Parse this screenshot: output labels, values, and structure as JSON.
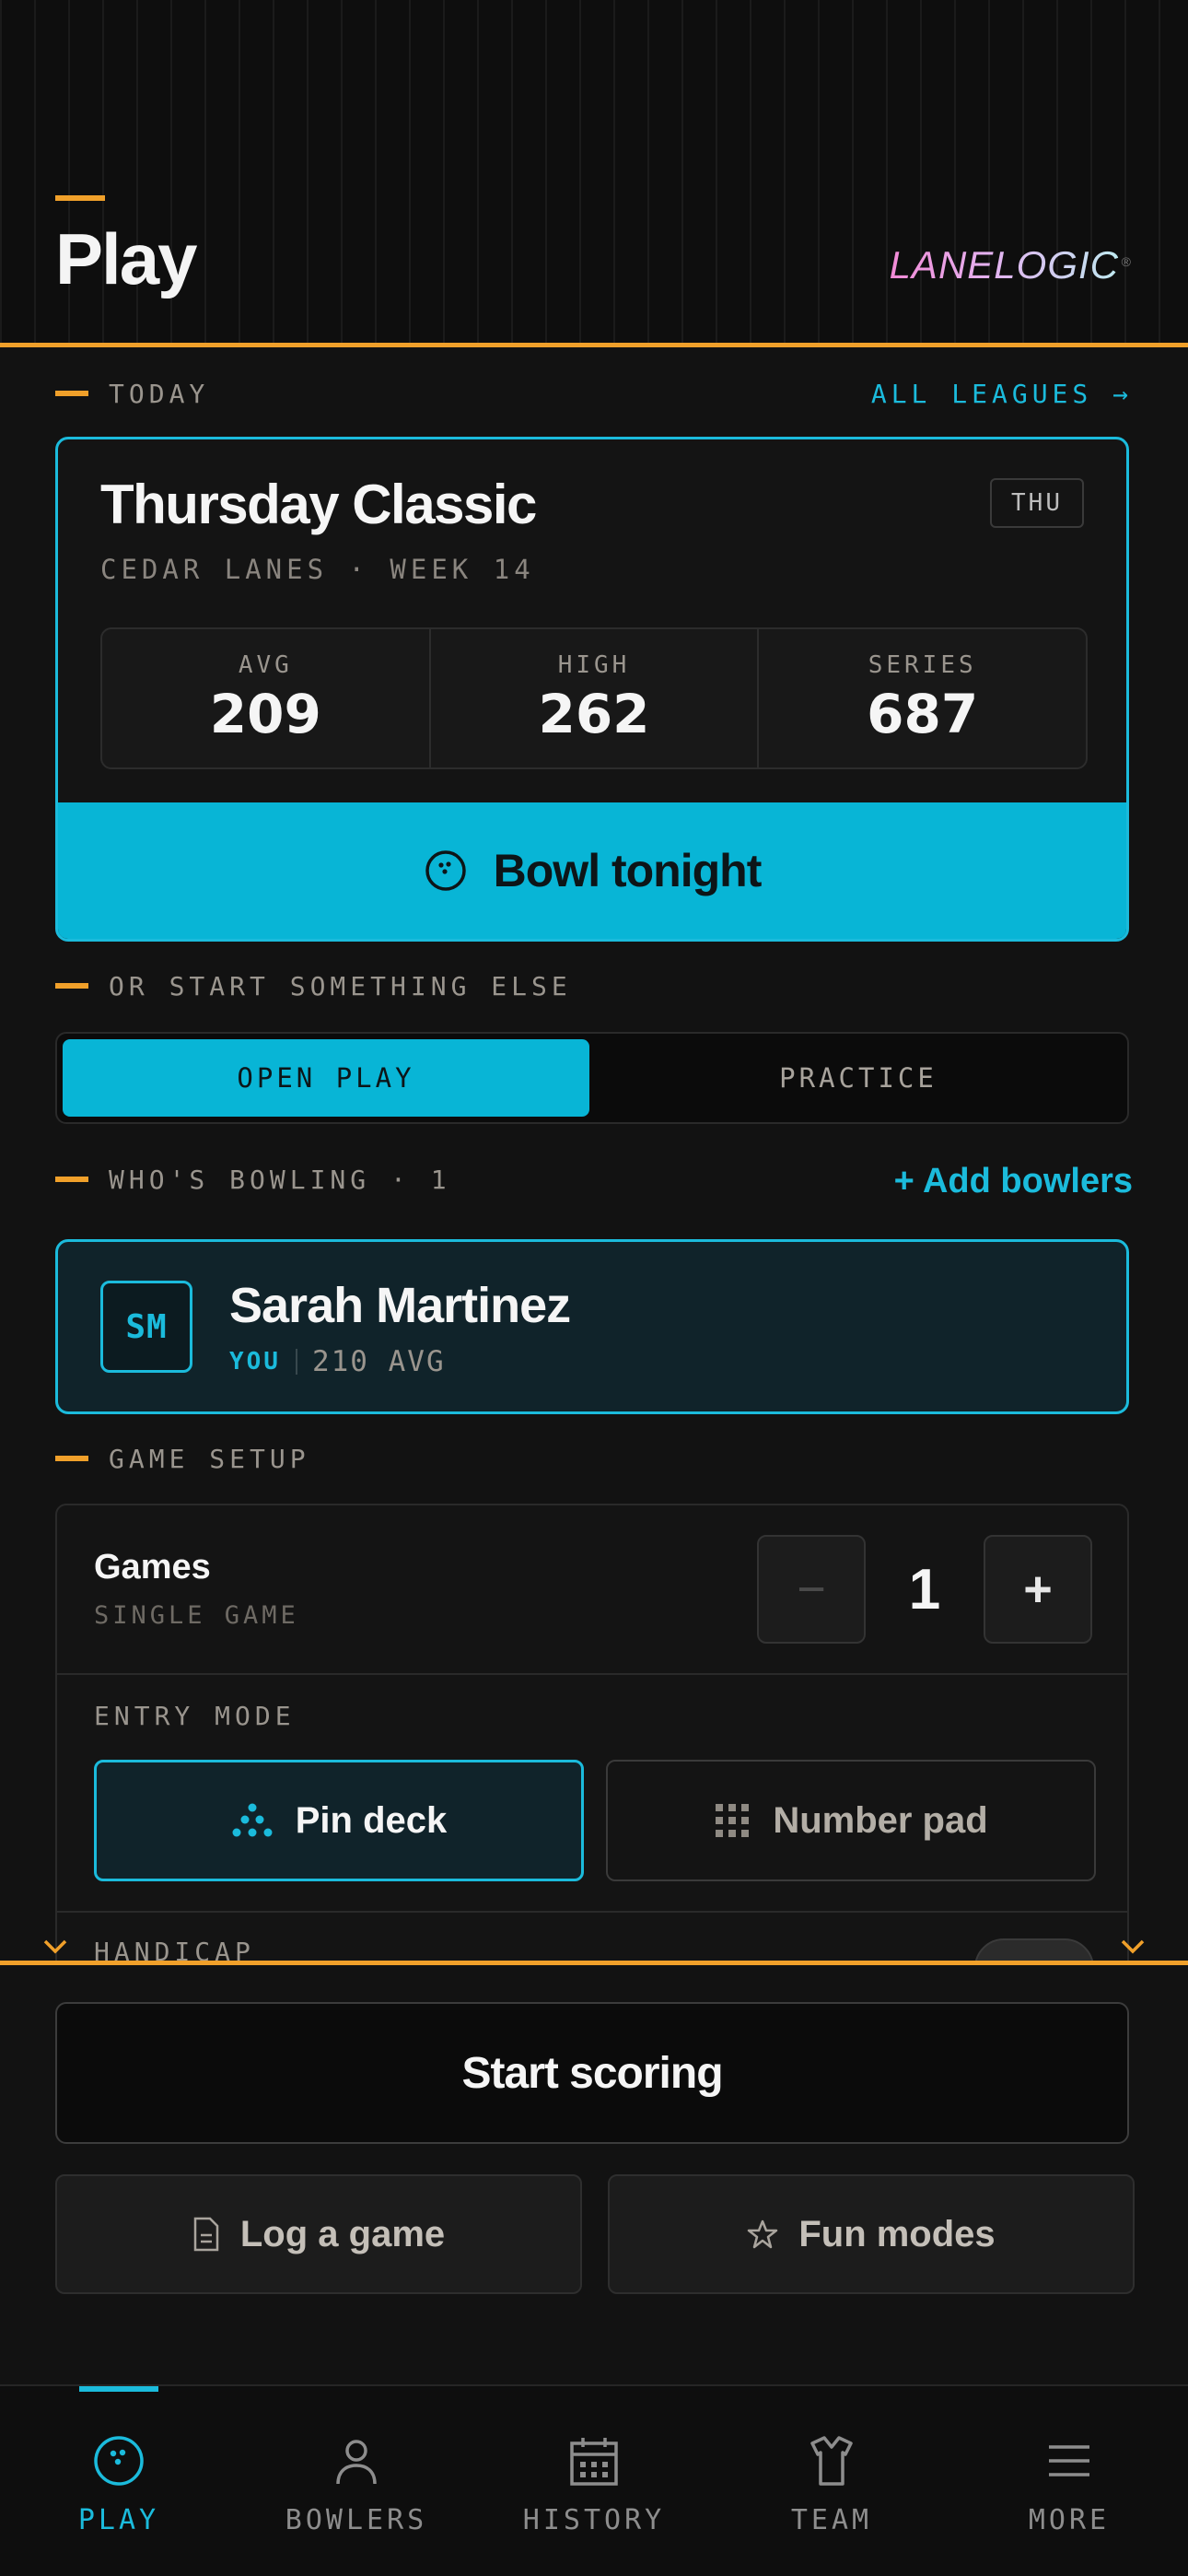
{
  "header": {
    "title": "Play",
    "brand": "LANELOGIC",
    "brand_mark": "®"
  },
  "today": {
    "label": "TODAY",
    "link": "ALL LEAGUES →",
    "league": {
      "name": "Thursday Classic",
      "subtitle": "CEDAR LANES · WEEK 14",
      "day": "THU",
      "stats": [
        {
          "label": "AVG",
          "value": "209"
        },
        {
          "label": "HIGH",
          "value": "262"
        },
        {
          "label": "SERIES",
          "value": "687"
        }
      ],
      "action": "Bowl tonight"
    }
  },
  "alt_start": {
    "label": "OR START SOMETHING ELSE",
    "options": [
      {
        "label": "OPEN PLAY",
        "selected": true
      },
      {
        "label": "PRACTICE",
        "selected": false
      }
    ]
  },
  "bowlers": {
    "label": "WHO'S BOWLING · 1",
    "add_link": "+ Add bowlers",
    "list": [
      {
        "initials": "SM",
        "name": "Sarah Martinez",
        "tag": "YOU",
        "avg": "210 AVG"
      }
    ]
  },
  "setup": {
    "label": "GAME SETUP",
    "games_label": "Games",
    "games_sub": "SINGLE GAME",
    "games_count": "1",
    "minus": "−",
    "plus": "+",
    "entry_label": "ENTRY MODE",
    "entry_modes": [
      {
        "label": "Pin deck",
        "selected": true
      },
      {
        "label": "Number pad",
        "selected": false
      }
    ],
    "handicap_label": "HANDICAP"
  },
  "actions": {
    "start": "Start scoring",
    "log": "Log a game",
    "fun": "Fun modes"
  },
  "tabs": [
    {
      "label": "PLAY",
      "active": true
    },
    {
      "label": "BOWLERS",
      "active": false
    },
    {
      "label": "HISTORY",
      "active": false
    },
    {
      "label": "TEAM",
      "active": false
    },
    {
      "label": "MORE",
      "active": false
    }
  ],
  "colors": {
    "accent": "#1bbbdc",
    "primary_button": "#08b5d6",
    "rule": "#f0a02a",
    "background": "#121212"
  }
}
